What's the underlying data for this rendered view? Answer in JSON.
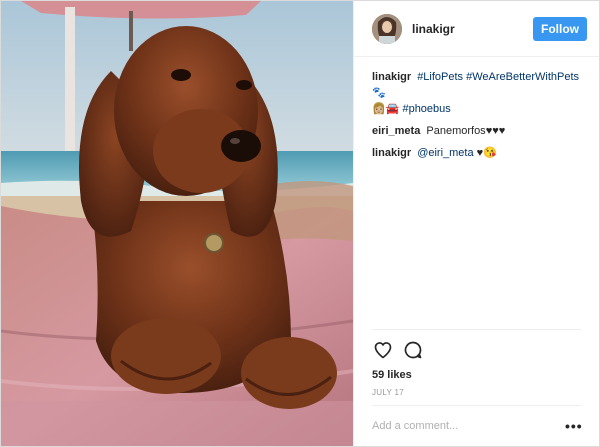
{
  "post": {
    "author": "linakigr",
    "follow_label": "Follow",
    "comments": [
      {
        "author": "linakigr",
        "parts": [
          {
            "type": "tag",
            "text": "#LifoPets"
          },
          {
            "type": "text",
            "text": " "
          },
          {
            "type": "tag",
            "text": "#WeAreBetterWithPets"
          },
          {
            "type": "emoji",
            "text": " 🐾"
          },
          {
            "type": "emoji",
            "text": " 👩🏼🚘 "
          },
          {
            "type": "tag",
            "text": "#phoebus"
          }
        ]
      },
      {
        "author": "eiri_meta",
        "parts": [
          {
            "type": "text",
            "text": "Panemorfos"
          },
          {
            "type": "emoji",
            "text": "♥♥♥"
          }
        ]
      },
      {
        "author": "linakigr",
        "parts": [
          {
            "type": "tag",
            "text": "@eiri_meta"
          },
          {
            "type": "text",
            "text": " "
          },
          {
            "type": "emoji",
            "text": "♥😘"
          }
        ]
      }
    ],
    "likes": "59 likes",
    "date": "JULY 17",
    "comment_placeholder": "Add a comment...",
    "more_label": "•••"
  },
  "icons": {
    "like": "heart-icon",
    "comment": "comment-bubble-icon",
    "more": "more-options-icon"
  },
  "colors": {
    "follow_bg": "#3897f0",
    "tag": "#003569",
    "border": "#efefef"
  }
}
